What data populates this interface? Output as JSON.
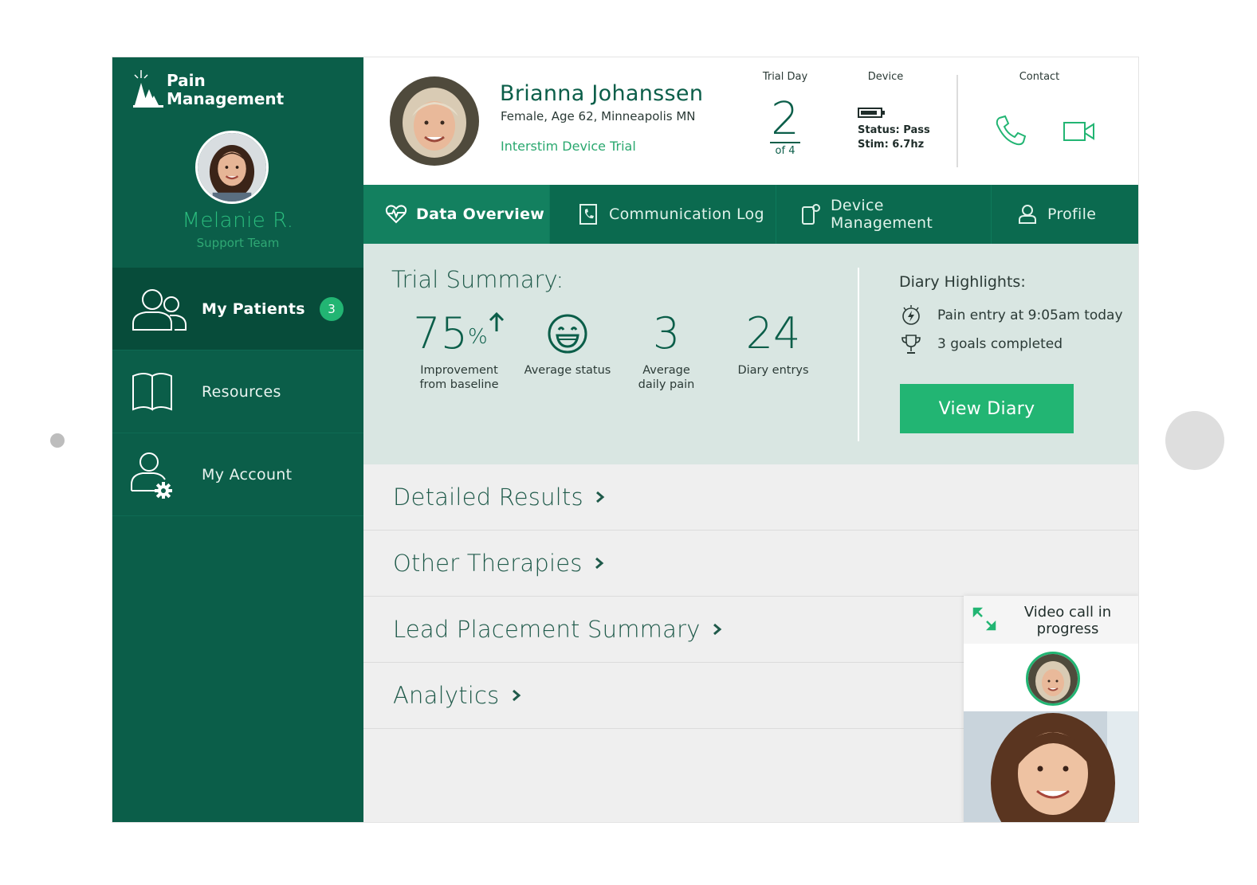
{
  "brand": {
    "line1": "Pain",
    "line2": "Management"
  },
  "user": {
    "name": "Melanie R.",
    "role": "Support Team"
  },
  "sidebar": {
    "items": [
      {
        "label": "My Patients",
        "badge": "3",
        "icon": "patients-icon"
      },
      {
        "label": "Resources",
        "icon": "book-icon"
      },
      {
        "label": "My Account",
        "icon": "account-settings-icon"
      }
    ]
  },
  "patient": {
    "name": "Brianna Johanssen",
    "meta": "Female, Age 62, Minneapolis MN",
    "trial": "Interstim Device Trial"
  },
  "header": {
    "trial_day_label": "Trial Day",
    "trial_day_value": "2",
    "trial_day_total": "of 4",
    "device_label": "Device",
    "device_status": "Status: Pass",
    "device_stim": "Stim: 6.7hz",
    "contact_label": "Contact"
  },
  "tabs": [
    {
      "label": "Data Overview",
      "icon": "heart-pulse-icon"
    },
    {
      "label": "Communication Log",
      "icon": "phone-log-icon"
    },
    {
      "label": "Device Management",
      "icon": "device-settings-icon"
    },
    {
      "label": "Profile",
      "icon": "user-icon"
    }
  ],
  "summary": {
    "title": "Trial Summary:",
    "stats": [
      {
        "value": "75",
        "unit": "%",
        "label1": "Improvement",
        "label2": "from baseline"
      },
      {
        "value": "",
        "label1": "Average status",
        "label2": ""
      },
      {
        "value": "3",
        "label1": "Average",
        "label2": "daily pain"
      },
      {
        "value": "24",
        "label1": "Diary entrys",
        "label2": ""
      }
    ]
  },
  "diary": {
    "title": "Diary Highlights:",
    "items": [
      {
        "text": "Pain entry at 9:05am today",
        "icon": "pain-bolt-icon"
      },
      {
        "text": "3 goals completed",
        "icon": "trophy-icon"
      }
    ],
    "button": "View Diary"
  },
  "sections": [
    {
      "label": "Detailed Results"
    },
    {
      "label": "Other Therapies"
    },
    {
      "label": "Lead Placement Summary"
    },
    {
      "label": "Analytics"
    }
  ],
  "video": {
    "title_line1": "Video call in",
    "title_line2": "progress"
  },
  "colors": {
    "sidebar": "#0b5e49",
    "accent": "#22b573",
    "tab_bar": "#0b6a4f",
    "summary_bg": "#d9e6e2"
  }
}
